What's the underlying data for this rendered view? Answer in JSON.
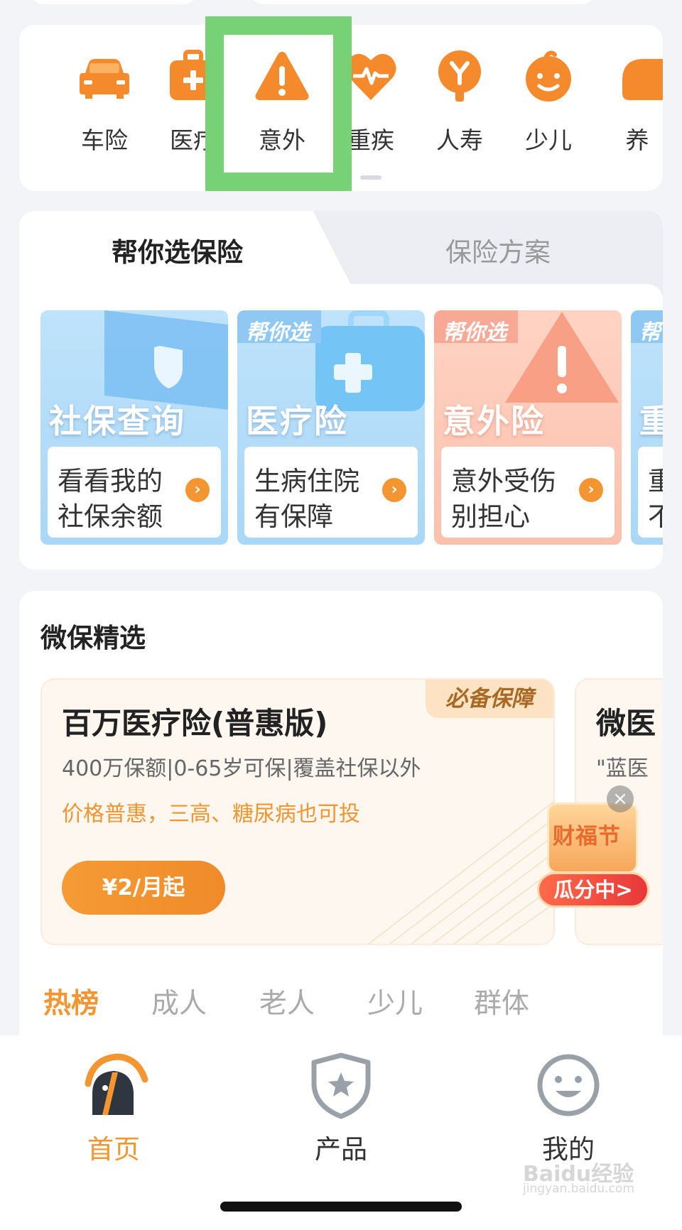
{
  "categories": [
    {
      "label": "车险",
      "icon": "car-icon"
    },
    {
      "label": "医疗",
      "icon": "medical-kit-icon"
    },
    {
      "label": "意外",
      "icon": "warning-icon"
    },
    {
      "label": "重疾",
      "icon": "heart-pulse-icon"
    },
    {
      "label": "人寿",
      "icon": "tree-icon"
    },
    {
      "label": "少儿",
      "icon": "baby-face-icon"
    },
    {
      "label": "养",
      "icon": "partial-icon"
    }
  ],
  "help": {
    "tab_active": "帮你选保险",
    "tab_inactive": "保险方案",
    "cards": [
      {
        "big": "社保查询",
        "line1": "看看我的",
        "line2": "社保余额",
        "badge": "",
        "theme": "blue"
      },
      {
        "big": "医疗险",
        "line1": "生病住院",
        "line2": "有保障",
        "badge": "帮你选",
        "theme": "blue"
      },
      {
        "big": "意外险",
        "line1": "意外受伤",
        "line2": "别担心",
        "badge": "帮你选",
        "theme": "red"
      },
      {
        "big": "重",
        "line1": "重",
        "line2": "不",
        "badge": "帮",
        "theme": "blue"
      }
    ]
  },
  "selection": {
    "title": "微保精选",
    "product": {
      "tag": "必备保障",
      "name": "百万医疗险(普惠版)",
      "desc": "400万保额|0-65岁可保|覆盖社保以外",
      "feature": "价格普惠，三高、糖尿病也可投",
      "price": "¥2/月起"
    },
    "product2": {
      "name": "微医",
      "desc": "\"蓝医"
    },
    "sub_tabs": [
      "热榜",
      "成人",
      "老人",
      "少儿",
      "群体"
    ]
  },
  "promo": {
    "title": "财福节",
    "button": "瓜分中>",
    "close": "×"
  },
  "nav": [
    {
      "label": "首页",
      "icon": "home-logo-icon",
      "active": true
    },
    {
      "label": "产品",
      "icon": "shield-star-icon",
      "active": false
    },
    {
      "label": "我的",
      "icon": "smiley-icon",
      "active": false
    }
  ],
  "watermark": {
    "text": "Baidu经验",
    "sub": "jingyan.baidu.com"
  },
  "colors": {
    "accent": "#f39530",
    "highlight": "#77d275",
    "page_bg": "#f2f4f8"
  }
}
